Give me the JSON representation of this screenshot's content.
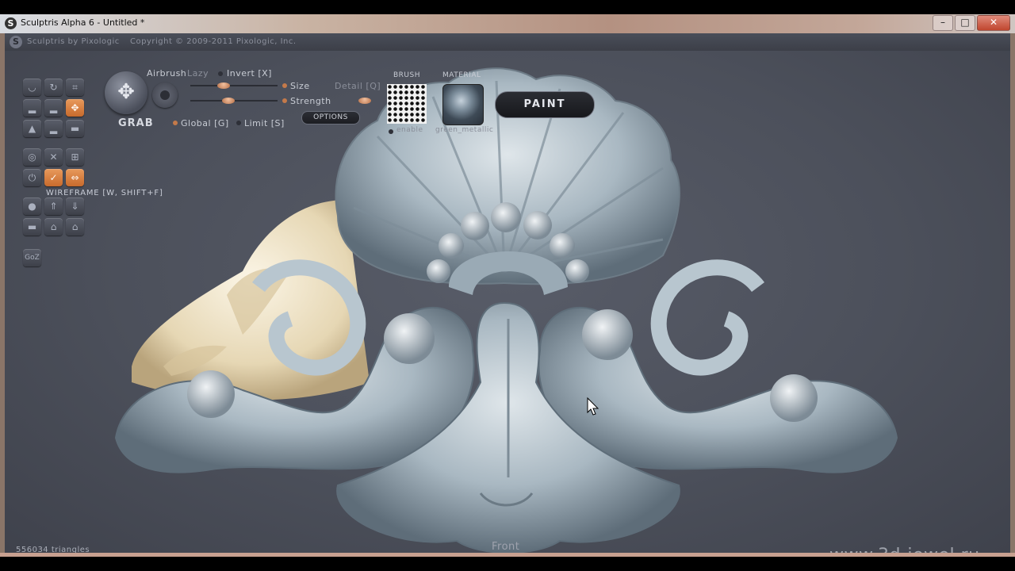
{
  "window": {
    "title": "Sculptris Alpha 6 - Untitled *",
    "buttons": {
      "minimize": "–",
      "maximize": "□",
      "close": "✕"
    }
  },
  "header": {
    "app_name": "Sculptris by Pixologic",
    "copyright": "Copyright © 2009-2011 Pixologic, Inc."
  },
  "tool": {
    "name": "GRAB",
    "airbrush": "Airbrush",
    "lazy": "Lazy",
    "invert": "Invert [X]",
    "size": "Size",
    "detail": "Detail [Q]",
    "strength": "Strength",
    "global": "Global [G]",
    "limit": "Limit [S]",
    "options": "OPTIONS",
    "size_level": 0.55,
    "strength_level": 0.6
  },
  "brush": {
    "header": "BRUSH",
    "name": "enable"
  },
  "material": {
    "header": "MATERIAL",
    "name": "green_metallic"
  },
  "paint_button": "PAINT",
  "tooltip": "WIREFRAME [W, SHIFT+F]",
  "status": "556034 triangles",
  "view_label": "Front",
  "watermark": "www.3d-jewel.ru",
  "colors": {
    "accent": "#d27a3c",
    "viewport": "#4c505b",
    "model": "#b8c6cf",
    "reference": "#efe4c8"
  },
  "icons": {
    "grab": "move-arrows-icon",
    "active_tool": "grab-tool-icon",
    "goz": "GoZ"
  }
}
